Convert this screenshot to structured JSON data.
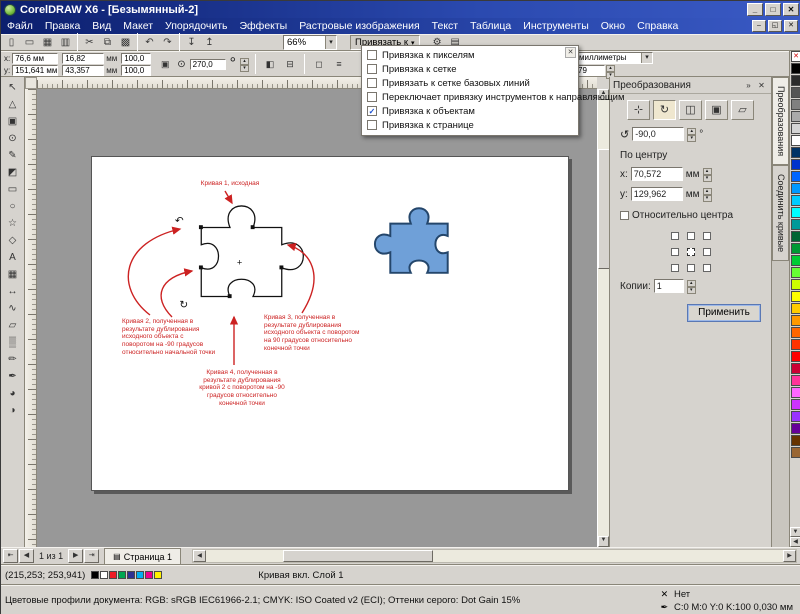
{
  "ui": {
    "caret": "▾",
    "left": "◀",
    "right": "▶",
    "up": "▲",
    "down": "▼",
    "chev_right": "»",
    "close": "✕",
    "deg": "°"
  },
  "window": {
    "title": "CorelDRAW X6 - [Безымянный-2]",
    "minimize": "_",
    "maximize": "□",
    "close": "✕"
  },
  "menubar": {
    "items": [
      "Файл",
      "Правка",
      "Вид",
      "Макет",
      "Упорядочить",
      "Эффекты",
      "Растровые изображения",
      "Текст",
      "Таблица",
      "Инструменты",
      "Окно",
      "Справка"
    ],
    "doc_minimize": "–",
    "doc_restore": "◱",
    "doc_close": "✕"
  },
  "toolbar": {
    "icons": [
      {
        "name": "new",
        "glyph": "▯"
      },
      {
        "name": "open",
        "glyph": "▭"
      },
      {
        "name": "save",
        "glyph": "▦"
      },
      {
        "name": "print",
        "glyph": "▥"
      },
      {
        "name": "cut",
        "glyph": "✂"
      },
      {
        "name": "copy",
        "glyph": "⧉"
      },
      {
        "name": "paste",
        "glyph": "▩"
      },
      {
        "name": "undo",
        "glyph": "↶"
      },
      {
        "name": "redo",
        "glyph": "↷"
      },
      {
        "name": "import",
        "glyph": "↧"
      },
      {
        "name": "export",
        "glyph": "↥"
      },
      {
        "name": "options",
        "glyph": "⚙"
      },
      {
        "name": "app-launcher",
        "glyph": "▤"
      }
    ],
    "zoom_value": "66%",
    "snap_label": "Привязать к"
  },
  "property_bar": {
    "x_label": "x:",
    "x_value": "76,6 мм",
    "y_label": "y:",
    "y_value": "151,641 мм",
    "width_value": "16,82",
    "width_unit": "мм",
    "height_value": "43,357",
    "height_unit": "мм",
    "scale_x": "100,0",
    "scale_y": "100,0",
    "lock_glyph": "▣",
    "angle_glyph": "⊙",
    "angle_value": "270,0",
    "angle_suffix": "°",
    "mirror_h": "◧",
    "mirror_v": "⊟",
    "extra1": "◻",
    "extra2": "≡",
    "units_value": "миллиметры",
    "nudge_value": "79"
  },
  "snap_menu": {
    "close": "✕",
    "items": [
      {
        "label": "Привязка к пикселям",
        "check": ""
      },
      {
        "label": "Привязка к сетке",
        "check": ""
      },
      {
        "label": "Привязать к сетке базовых линий",
        "check": ""
      },
      {
        "label": "Переключает привязку инструментов к направляющим",
        "check": ""
      },
      {
        "label": "Привязка к объектам",
        "check": "✓"
      },
      {
        "label": "Привязка к странице",
        "check": ""
      }
    ]
  },
  "toolbox": {
    "tools": [
      {
        "name": "pick",
        "glyph": "↖"
      },
      {
        "name": "shape",
        "glyph": "△"
      },
      {
        "name": "crop",
        "glyph": "▣"
      },
      {
        "name": "zoom",
        "glyph": "⊙"
      },
      {
        "name": "freehand",
        "glyph": "✎"
      },
      {
        "name": "smart-fill",
        "glyph": "◩"
      },
      {
        "name": "rectangle",
        "glyph": "▭"
      },
      {
        "name": "ellipse",
        "glyph": "○"
      },
      {
        "name": "polygon",
        "glyph": "☆"
      },
      {
        "name": "basic-shapes",
        "glyph": "◇"
      },
      {
        "name": "text",
        "glyph": "А"
      },
      {
        "name": "table",
        "glyph": "▦"
      },
      {
        "name": "dimension",
        "glyph": "↔"
      },
      {
        "name": "connector",
        "glyph": "∿"
      },
      {
        "name": "blend",
        "glyph": "▱"
      },
      {
        "name": "transparency",
        "glyph": "▒"
      },
      {
        "name": "eyedropper",
        "glyph": "✏"
      },
      {
        "name": "outline-pen",
        "glyph": "✒"
      },
      {
        "name": "fill",
        "glyph": "◕"
      },
      {
        "name": "interactive-fill",
        "glyph": "◑"
      }
    ]
  },
  "canvas": {
    "annotations": {
      "curve1": "Кривая 1, исходная",
      "curve2": "Кривая 2, полученная в результате дублирования исходного объекта с поворотом на -90 градусов относительно начальной точки",
      "curve3": "Кривая 3, полученная в результате дублирования исходного объекта с поворотом на 90 градусов относительно конечной точки",
      "curve4": "Кривая 4, полученная в результате дублирования кривой 2 с поворотом на -90 градусов относительно конечной точки"
    },
    "colors": {
      "puzzle_fill": "#6fa0d8",
      "puzzle_stroke": "#24466b",
      "annotation": "#cc2222"
    }
  },
  "docker": {
    "title": "Преобразования",
    "types": [
      {
        "name": "position",
        "glyph": "⊹"
      },
      {
        "name": "rotate",
        "glyph": "↻"
      },
      {
        "name": "scale-mirror",
        "glyph": "◫"
      },
      {
        "name": "size",
        "glyph": "▣"
      },
      {
        "name": "skew",
        "glyph": "▱"
      }
    ],
    "angle_glyph": "↺",
    "angle_value": "-90,0",
    "angle_suffix": "°",
    "center_label": "По центру",
    "x_label": "x:",
    "x_value": "70,572",
    "x_unit": "мм",
    "y_label": "y:",
    "y_value": "129,962",
    "y_unit": "мм",
    "relative_center_label": "Относительно центра",
    "copies_label": "Копии:",
    "copies_value": "1",
    "apply_label": "Применить",
    "side_tabs": [
      "Преобразования",
      "Соединить кривые"
    ]
  },
  "palette": {
    "colors": [
      "none",
      "#000000",
      "#2b2b2b",
      "#555555",
      "#808080",
      "#aaaaaa",
      "#d4d4d4",
      "#ffffff",
      "#003366",
      "#0033cc",
      "#0066ff",
      "#0099ff",
      "#00ccff",
      "#00ffff",
      "#009999",
      "#006633",
      "#009933",
      "#00cc33",
      "#66ff33",
      "#ccff00",
      "#ffff00",
      "#ffcc00",
      "#ff9900",
      "#ff6600",
      "#ff3300",
      "#ff0000",
      "#cc0033",
      "#ff3399",
      "#ff66ff",
      "#cc33ff",
      "#9933ff",
      "#660099",
      "#663300",
      "#996633"
    ]
  },
  "pagebar": {
    "first": "⇤",
    "prev": "◀",
    "indicator": "1 из 1",
    "next": "▶",
    "last": "⇥",
    "tab_icon": "▤",
    "tab_label": "Страница 1"
  },
  "statusbar": {
    "cursor_pos": "(215,253; 253,941)",
    "swatches": [
      "#000000",
      "#ffffff",
      "#ee1c25",
      "#00a651",
      "#2e3192",
      "#00aeef",
      "#ec008c",
      "#fff200"
    ],
    "object_info": "Кривая вкл. Слой 1",
    "profiles": "Цветовые профили документа: RGB: sRGB IEC61966-2.1; CMYK: ISO Coated v2 (ECI); Оттенки серого: Dot Gain 15%",
    "fill_icon": "✕",
    "fill_label": "Нет",
    "outline_icon": "✒",
    "outline_label": "C:0 M:0 Y:0 K:100  0,030 мм"
  }
}
